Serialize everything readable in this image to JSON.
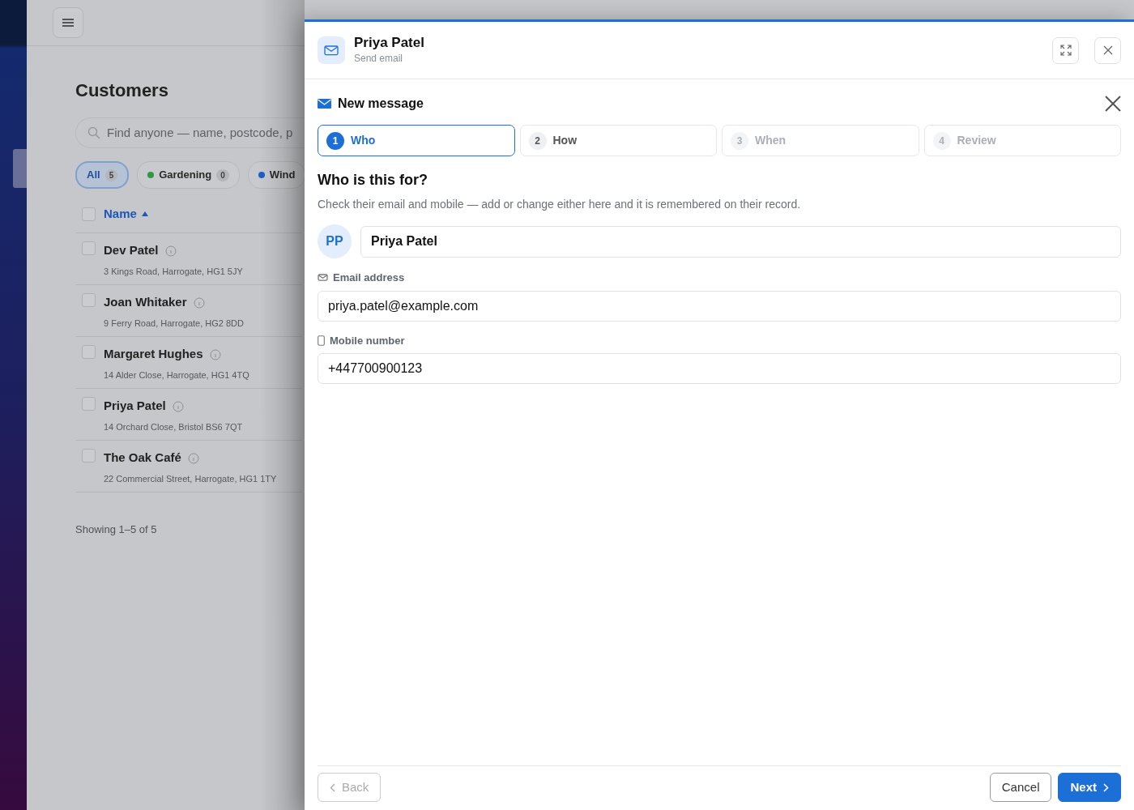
{
  "background": {
    "title": "Customers",
    "search": {
      "placeholder": "Find anyone — name, postcode, p"
    },
    "filters": [
      {
        "label": "All",
        "count": "5",
        "selected": true
      },
      {
        "label": "Gardening",
        "count": "0",
        "color": "#2e9a48",
        "selected": false
      },
      {
        "label": "Wind",
        "color": "#1c5fc8",
        "selected": false
      }
    ],
    "select_all_checked": false,
    "sort_column": "Name",
    "customers": [
      {
        "name": "Dev Patel",
        "address": "3 Kings Road, Harrogate, HG1 5JY",
        "checked": false
      },
      {
        "name": "Joan Whitaker",
        "address": "9 Ferry Road, Harrogate, HG2 8DD",
        "checked": false
      },
      {
        "name": "Margaret Hughes",
        "address": "14 Alder Close, Harrogate, HG1 4TQ",
        "checked": false
      },
      {
        "name": "Priya Patel",
        "address": "14 Orchard Close, Bristol BS6 7QT",
        "checked": false
      },
      {
        "name": "The Oak Café",
        "address": "22 Commercial Street, Harrogate, HG1 1TY",
        "checked": false
      }
    ],
    "footer": "Showing 1–5 of 5"
  },
  "drawer": {
    "title": "Priya Patel",
    "subtitle": "Send email"
  },
  "composer": {
    "title": "New message",
    "steps": [
      {
        "number": "1",
        "label": "Who",
        "selected": true,
        "disabled": false
      },
      {
        "number": "2",
        "label": "How",
        "selected": false,
        "disabled": false
      },
      {
        "number": "3",
        "label": "When",
        "selected": false,
        "disabled": true
      },
      {
        "number": "4",
        "label": "Review",
        "selected": false,
        "disabled": true
      }
    ],
    "heading": "Who is this for?",
    "description": "Check their email and mobile — add or change either here and it is remembered on their record.",
    "recipient": {
      "initials": "PP",
      "name": "Priya Patel"
    },
    "fields": [
      {
        "kind": "email",
        "label": "Email address",
        "value": "priya.patel@example.com"
      },
      {
        "kind": "phone",
        "label": "Mobile number",
        "value": "+447700900123"
      }
    ],
    "buttons": [
      {
        "kind": "back",
        "label": "Back",
        "disabled": true
      },
      {
        "kind": "cancel",
        "label": "Cancel",
        "disabled": false
      },
      {
        "kind": "next",
        "label": "Next",
        "disabled": false
      }
    ]
  }
}
